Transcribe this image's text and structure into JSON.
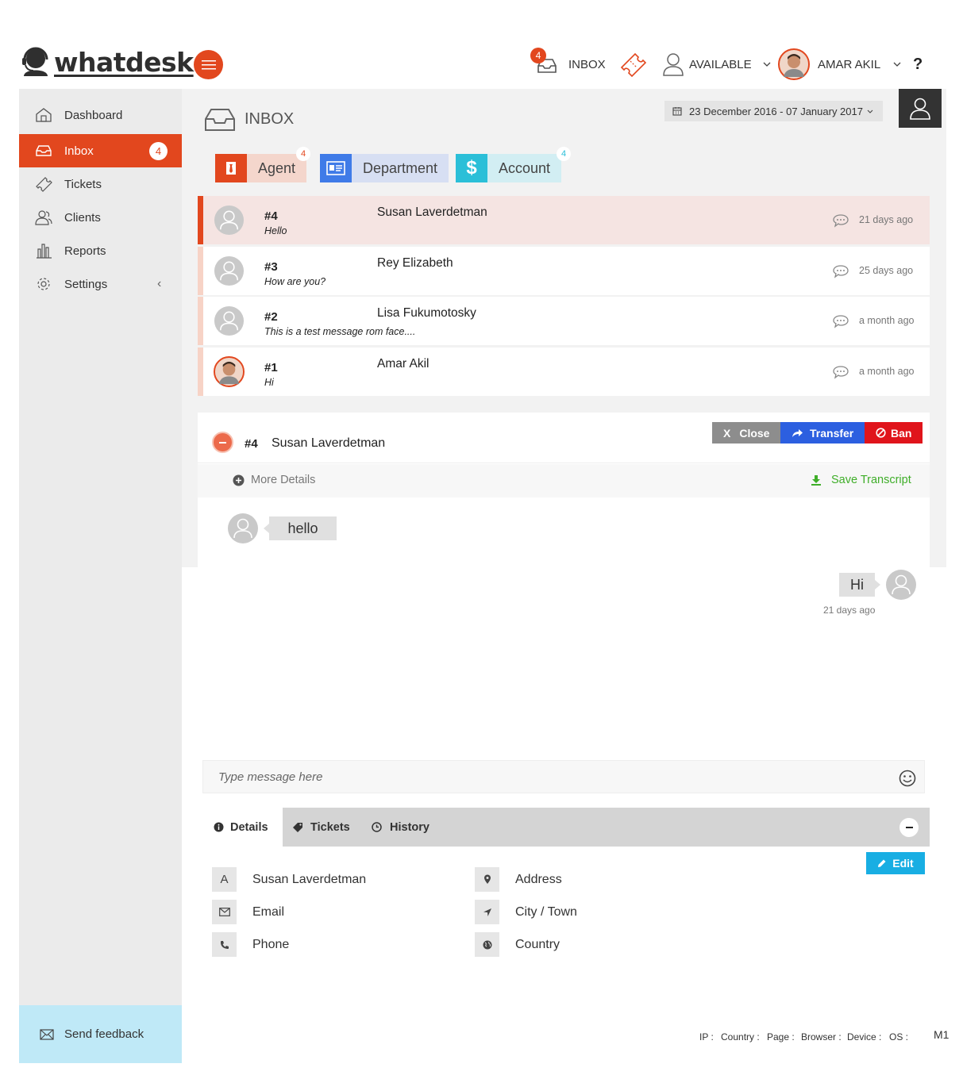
{
  "brand": {
    "name": "whatdesk"
  },
  "topbar": {
    "inbox_label": "INBOX",
    "inbox_badge": "4",
    "status_label": "AVAILABLE",
    "user_name": "AMAR AKIL",
    "help_label": "?"
  },
  "sidebar": {
    "items": [
      {
        "label": "Dashboard",
        "icon": "dashboard-icon"
      },
      {
        "label": "Inbox",
        "icon": "inbox-icon",
        "badge": "4",
        "active": true
      },
      {
        "label": "Tickets",
        "icon": "ticket-icon"
      },
      {
        "label": "Clients",
        "icon": "clients-icon"
      },
      {
        "label": "Reports",
        "icon": "reports-icon"
      },
      {
        "label": "Settings",
        "icon": "gear-icon",
        "chevron": "‹"
      }
    ],
    "feedback_label": "Send feedback"
  },
  "header": {
    "title": "INBOX",
    "date_range": "23 December 2016 - 07 January 2017"
  },
  "filters": [
    {
      "label": "Agent",
      "badge": "4",
      "color": "#e2471e",
      "bg": "#f4d6cc"
    },
    {
      "label": "Department",
      "badge": "",
      "color": "#3f7be8",
      "bg": "#d7dff3"
    },
    {
      "label": "Account",
      "badge": "4",
      "color": "#2bbfd8",
      "bg": "#d2eef3"
    }
  ],
  "conversations": [
    {
      "number": "#4",
      "message": "Hello",
      "name": "Susan Laverdetman",
      "time": "21 days ago",
      "selected": true
    },
    {
      "number": "#3",
      "message": "How are you?",
      "name": "Rey Elizabeth",
      "time": "25 days ago"
    },
    {
      "number": "#2",
      "message": "This is a test message rom face....",
      "name": "Lisa Fukumotosky",
      "time": "a month ago"
    },
    {
      "number": "#1",
      "message": "Hi",
      "name": "Amar Akil",
      "time": "a month ago"
    }
  ],
  "chat": {
    "number": "#4",
    "name": "Susan Laverdetman",
    "close_label": "Close",
    "close_prefix": "X",
    "transfer_label": "Transfer",
    "ban_label": "Ban",
    "more_details_label": "More Details",
    "save_transcript_label": "Save Transcript",
    "messages": [
      {
        "text": "hello",
        "from": "client"
      },
      {
        "text": "Hi",
        "from": "agent",
        "time": "21 days ago"
      }
    ],
    "input_placeholder": "Type message here"
  },
  "details": {
    "tabs": [
      "Details",
      "Tickets",
      "History"
    ],
    "edit_label": "Edit",
    "left_fields": [
      {
        "icon_text": "A",
        "value": "Susan Laverdetman"
      },
      {
        "icon": "envelope-icon",
        "value": "Email"
      },
      {
        "icon": "phone-icon",
        "value": "Phone"
      }
    ],
    "right_fields": [
      {
        "icon": "map-marker-icon",
        "value": "Address"
      },
      {
        "icon": "location-arrow-icon",
        "value": "City / Town"
      },
      {
        "icon": "globe-icon",
        "value": "Country"
      }
    ]
  },
  "status_bar": {
    "items": [
      "IP :",
      "Country :",
      "Page :",
      "Browser :",
      "Device :",
      "OS :"
    ],
    "cut_text": "M1"
  },
  "colors": {
    "accent": "#e2471e",
    "transfer": "#2c5fe0",
    "ban": "#e0141b",
    "close": "#8d8d8d",
    "edit": "#18aee3",
    "save": "#3fae29"
  }
}
